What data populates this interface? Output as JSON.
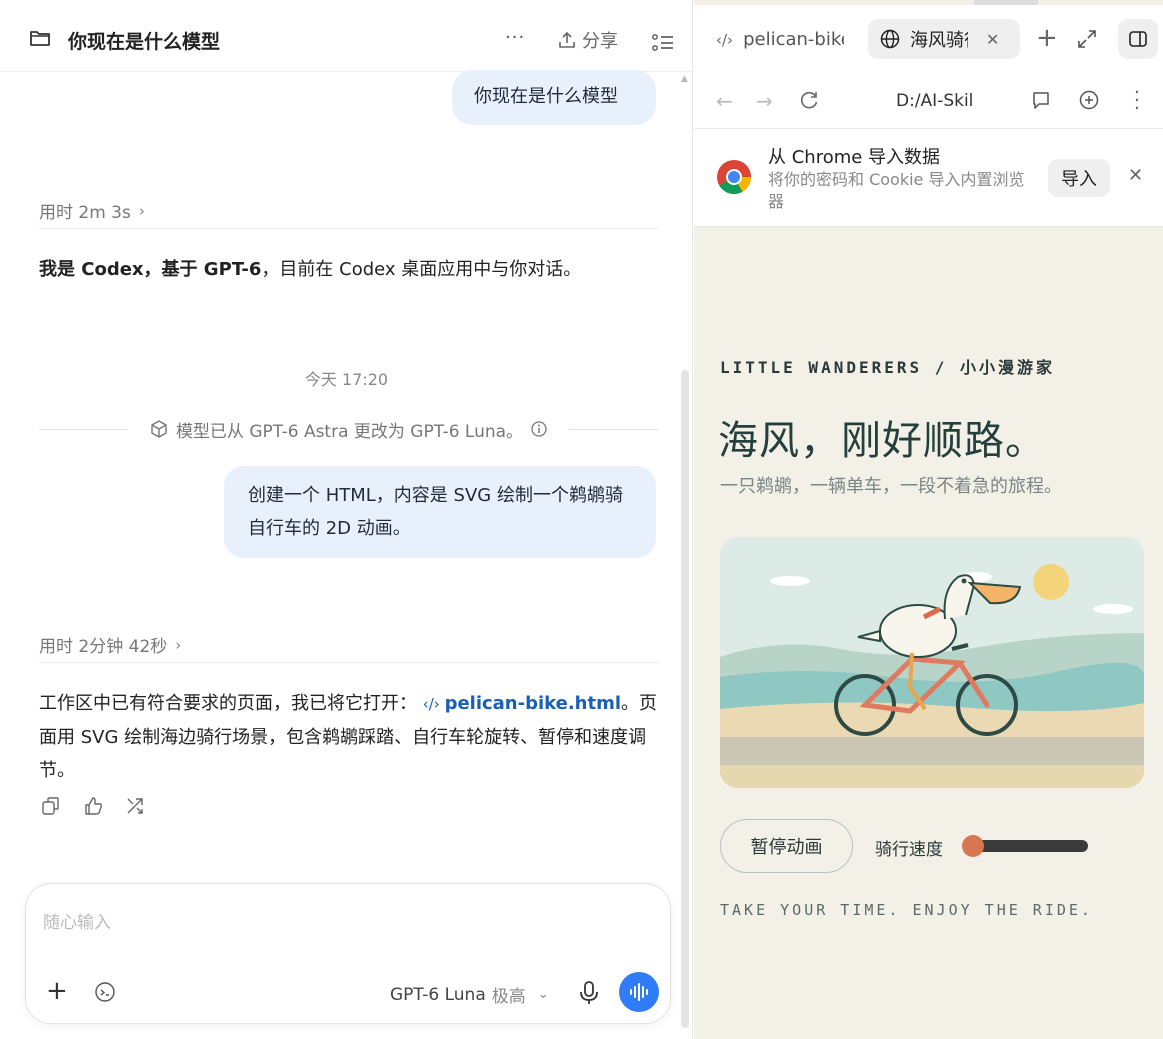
{
  "chat": {
    "title": "你现在是什么模型",
    "more": "···",
    "share_label": "分享",
    "messages": {
      "user1": "你现在是什么模型",
      "timing1": "用时 2m 3s",
      "answer1_bold": "我是 Codex，基于 GPT-6",
      "answer1_rest": "，目前在 Codex 桌面应用中与你对话。",
      "day_separator": "今天 17:20",
      "model_change": "模型已从 GPT-6 Astra 更改为 GPT-6 Luna。",
      "user2": "创建一个 HTML，内容是 SVG 绘制一个鹈鹕骑自行车的 2D 动画。",
      "timing2": "用时 2分钟 42秒",
      "answer2_before": "工作区中已有符合要求的页面，我已将它打开：",
      "answer2_link": "pelican-bike.html",
      "answer2_after": "。页面用 SVG 绘制海边骑行场景，包含鹈鹕踩踏、自行车轮旋转、暂停和速度调节。"
    },
    "composer": {
      "placeholder": "随心输入",
      "model": "GPT-6 Luna",
      "effort": "极高"
    }
  },
  "browser": {
    "tabs": [
      {
        "label": "pelican-bike.html"
      },
      {
        "label": "海风骑行"
      }
    ],
    "url": "D:/AI-Skills",
    "import_banner": {
      "title": "从 Chrome 导入数据",
      "description": "将你的密码和 Cookie 导入内置浏览器",
      "button": "导入"
    },
    "site": {
      "brand": "LITTLE WANDERERS / 小小漫游家",
      "title": "海风，刚好顺路。",
      "subtitle": "一只鹈鹕，一辆单车，一段不着急的旅程。",
      "pause_button": "暂停动画",
      "speed_label": "骑行速度",
      "speed_value": 0.05,
      "tagline": "TAKE YOUR TIME. ENJOY THE RIDE."
    }
  },
  "colors": {
    "accent_blue": "#2f7cf6",
    "user_bubble": "#e8f1fb",
    "link": "#1a5fb4",
    "page_bg": "#f3f0e8",
    "speed_accent": "#d87650"
  }
}
